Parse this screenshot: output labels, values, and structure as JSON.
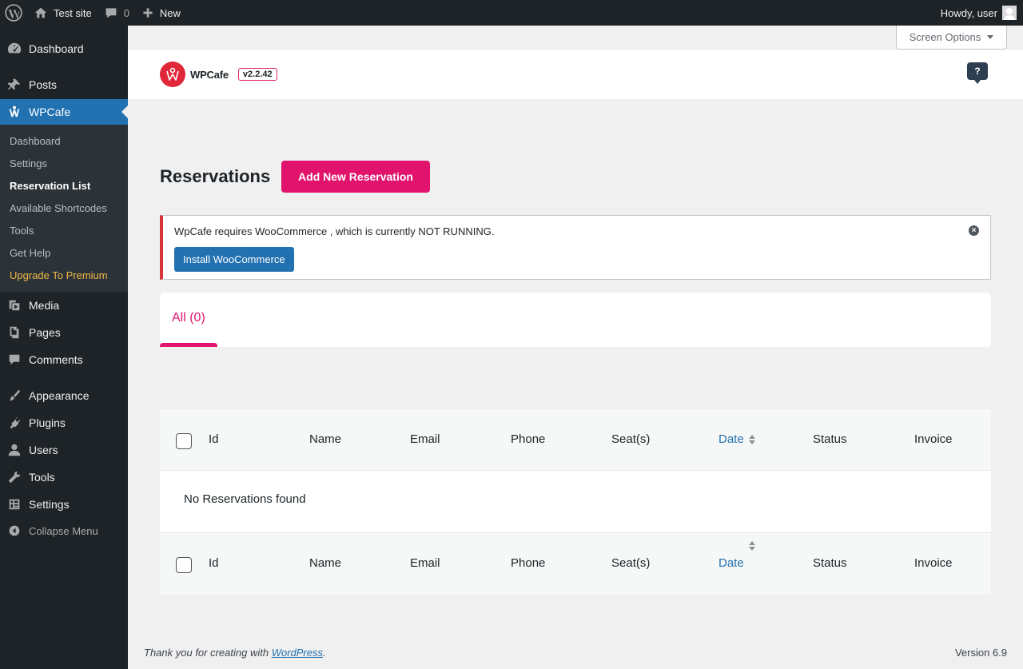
{
  "adminbar": {
    "site_name": "Test site",
    "comments_count": "0",
    "new_label": "New",
    "howdy": "Howdy, user"
  },
  "sidebar": {
    "items": [
      {
        "label": "Dashboard",
        "icon": "dashboard-icon"
      },
      {
        "label": "Posts",
        "icon": "pin-icon"
      },
      {
        "label": "WPCafe",
        "icon": "wpcafe-icon"
      },
      {
        "label": "Media",
        "icon": "media-icon"
      },
      {
        "label": "Pages",
        "icon": "pages-icon"
      },
      {
        "label": "Comments",
        "icon": "comment-icon"
      },
      {
        "label": "Appearance",
        "icon": "brush-icon"
      },
      {
        "label": "Plugins",
        "icon": "plug-icon"
      },
      {
        "label": "Users",
        "icon": "user-icon"
      },
      {
        "label": "Tools",
        "icon": "wrench-icon"
      },
      {
        "label": "Settings",
        "icon": "settings-icon"
      }
    ],
    "submenu": [
      "Dashboard",
      "Settings",
      "Reservation List",
      "Available Shortcodes",
      "Tools",
      "Get Help",
      "Upgrade To Premium"
    ],
    "collapse": "Collapse Menu"
  },
  "screen_options": "Screen Options",
  "plugin": {
    "name": "WPCafe",
    "version": "v2.2.42",
    "help": "?"
  },
  "page": {
    "title": "Reservations",
    "add_button": "Add New Reservation"
  },
  "notice": {
    "text": "WpCafe requires WooCommerce , which is currently NOT RUNNING.",
    "button": "Install WooCommerce"
  },
  "tabs": {
    "all": "All (0)"
  },
  "table": {
    "columns": [
      "Id",
      "Name",
      "Email",
      "Phone",
      "Seat(s)",
      "Date",
      "Status",
      "Invoice"
    ],
    "empty": "No Reservations found"
  },
  "footer": {
    "thanks_prefix": "Thank you for creating with ",
    "thanks_link": "WordPress",
    "thanks_suffix": ".",
    "version": "Version 6.9"
  },
  "colors": {
    "accent": "#e1136d",
    "wp_blue": "#2271b1",
    "admin_dark": "#1d2327",
    "error_red": "#d63638"
  }
}
